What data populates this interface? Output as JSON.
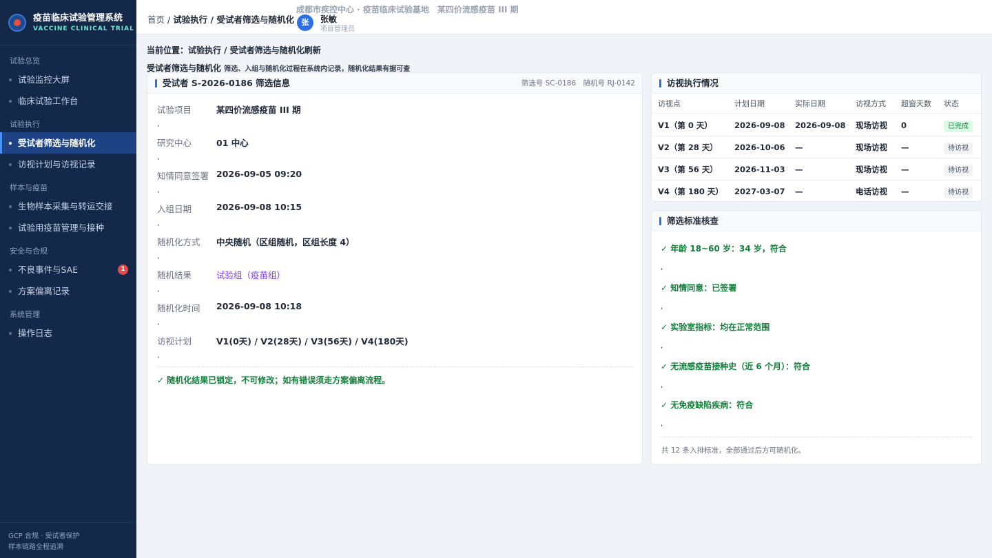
{
  "brand": {
    "logo_text": "RX",
    "title": "疫苗临床试验管理系统",
    "subtitle": "VACCINE CLINICAL TRIAL"
  },
  "sidebar": {
    "groups": [
      {
        "label": "试验总览",
        "items": [
          {
            "label": "试验监控大屏"
          },
          {
            "label": "临床试验工作台"
          }
        ]
      },
      {
        "label": "试验执行",
        "items": [
          {
            "label": "受试者筛选与随机化",
            "active": true
          },
          {
            "label": "访视计划与访视记录"
          }
        ]
      },
      {
        "label": "样本与疫苗",
        "items": [
          {
            "label": "生物样本采集与转运交接"
          },
          {
            "label": "试验用疫苗管理与接种"
          }
        ]
      },
      {
        "label": "安全与合规",
        "items": [
          {
            "label": "不良事件与SAE",
            "badge": "1"
          },
          {
            "label": "方案偏离记录"
          }
        ]
      },
      {
        "label": "系统管理",
        "items": [
          {
            "label": "操作日志"
          }
        ]
      }
    ],
    "footer": {
      "line1": "GCP 合规 · 受试者保护",
      "line2": "样本链路全程追溯"
    }
  },
  "topbar": {
    "crumb_home": "首页",
    "crumb_sep": " / ",
    "crumb_path": "试验执行 / 受试者筛选与随机化",
    "org": "成都市疾控中心 · 疫苗临床试验基地　某四价流感疫苗 III 期",
    "avatar": "张",
    "user_name": "张敏",
    "user_role": "项目管理员"
  },
  "page": {
    "location": "当前位置：试验执行 / 受试者筛选与随机化刷新",
    "section_title": "受试者筛选与随机化",
    "section_desc": "筛选、入组与随机化过程在系统内记录，随机化结果有据可查"
  },
  "subject": {
    "title": "受试者 S-2026-0186 筛选信息",
    "meta": "筛选号 SC-0186　随机号 RJ-0142",
    "fields": [
      {
        "label": "试验项目",
        "value": "某四价流感疫苗 III 期"
      },
      {
        "label": "研究中心",
        "value": "01 中心"
      },
      {
        "label": "知情同意签署",
        "value": "2026-09-05 09:20"
      },
      {
        "label": "入组日期",
        "value": "2026-09-08 10:15"
      },
      {
        "label": "随机化方式",
        "value": "中央随机（区组随机，区组长度 4）"
      },
      {
        "label": "随机结果",
        "value": "试验组（疫苗组）"
      },
      {
        "label": "随机化时间",
        "value": "2026-09-08 10:18"
      },
      {
        "label": "访视计划",
        "value": "V1(0天) / V2(28天) / V3(56天) / V4(180天)"
      }
    ],
    "separator": ",",
    "lock_note": "✓ 随机化结果已锁定，不可修改；如有错误须走方案偏离流程。",
    "accent_color": "#7c3aed"
  },
  "visits": {
    "title": "访视执行情况",
    "columns": [
      "访视点",
      "计划日期",
      "实际日期",
      "访视方式",
      "超窗天数",
      "状态"
    ],
    "rows": [
      {
        "point": "V1（第 0 天）",
        "plan": "2026-09-08",
        "actual": "2026-09-08",
        "mode": "现场访视",
        "over": "0",
        "status": "已完成",
        "status_type": "done"
      },
      {
        "point": "V2（第 28 天）",
        "plan": "2026-10-06",
        "actual": "—",
        "mode": "现场访视",
        "over": "—",
        "status": "待访视",
        "status_type": "wait"
      },
      {
        "point": "V3（第 56 天）",
        "plan": "2026-11-03",
        "actual": "—",
        "mode": "现场访视",
        "over": "—",
        "status": "待访视",
        "status_type": "wait"
      },
      {
        "point": "V4（第 180 天）",
        "plan": "2027-03-07",
        "actual": "—",
        "mode": "电话访视",
        "over": "—",
        "status": "待访视",
        "status_type": "wait"
      }
    ]
  },
  "criteria": {
    "title": "筛选标准核查",
    "items": [
      "✓ 年龄 18~60 岁：34 岁，符合",
      "✓ 知情同意：已签署",
      "✓ 实验室指标：均在正常范围",
      "✓ 无流感疫苗接种史（近 6 个月）：符合",
      "✓ 无免疫缺陷疾病：符合"
    ],
    "separator": ",",
    "note": "共 12 条入排标准，全部通过后方可随机化。"
  },
  "colors": {
    "sidebar_bg": "#14284a",
    "accent": "#2f6fe4",
    "ok": "#15803d",
    "badge": "#e5484d"
  }
}
